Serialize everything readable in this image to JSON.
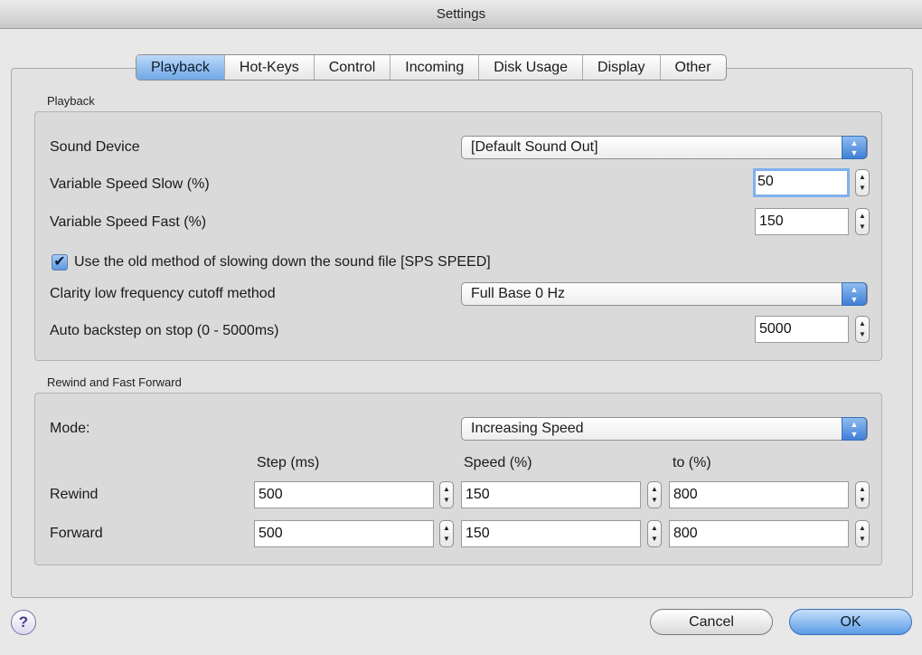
{
  "window": {
    "title": "Settings"
  },
  "tabs": [
    {
      "label": "Playback",
      "active": true
    },
    {
      "label": "Hot-Keys"
    },
    {
      "label": "Control"
    },
    {
      "label": "Incoming"
    },
    {
      "label": "Disk Usage"
    },
    {
      "label": "Display"
    },
    {
      "label": "Other"
    }
  ],
  "playback": {
    "section_label": "Playback",
    "sound_device": {
      "label": "Sound Device",
      "value": "[Default Sound Out]"
    },
    "speed_slow": {
      "label": "Variable Speed Slow (%)",
      "value": "50"
    },
    "speed_fast": {
      "label": "Variable Speed Fast (%)",
      "value": "150"
    },
    "old_method": {
      "label": "Use the old method of slowing down the sound file [SPS SPEED]",
      "checked": true
    },
    "clarity": {
      "label": "Clarity low frequency cutoff method",
      "value": "Full Base 0 Hz"
    },
    "backstep": {
      "label": "Auto backstep on stop (0 - 5000ms)",
      "value": "5000"
    }
  },
  "rewind_ff": {
    "section_label": "Rewind and Fast Forward",
    "mode": {
      "label": "Mode:",
      "value": "Increasing Speed"
    },
    "headers": {
      "step": "Step (ms)",
      "speed": "Speed (%)",
      "to": "to (%)"
    },
    "rewind": {
      "label": "Rewind",
      "step": "500",
      "speed": "150",
      "to": "800"
    },
    "forward": {
      "label": "Forward",
      "step": "500",
      "speed": "150",
      "to": "800"
    }
  },
  "footer": {
    "help": "?",
    "cancel": "Cancel",
    "ok": "OK"
  },
  "colors": {
    "accent": "#5a9be6",
    "focus_ring": "#7fb0ec"
  }
}
